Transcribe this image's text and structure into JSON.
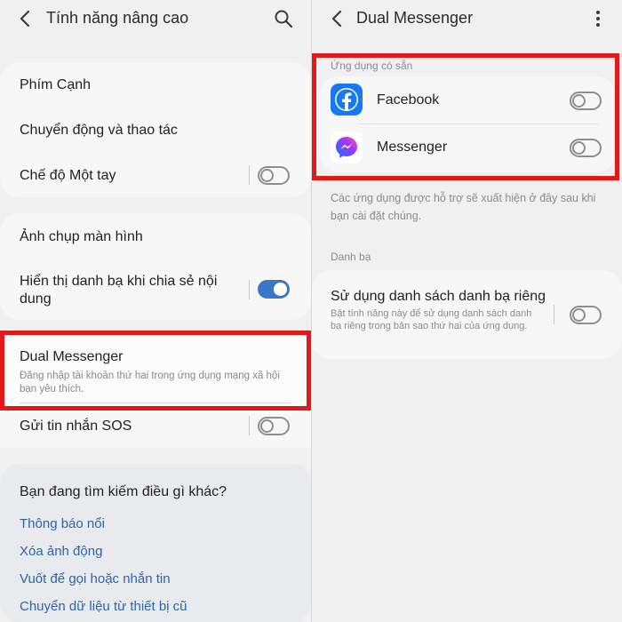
{
  "left": {
    "title": "Tính năng nâng cao",
    "items": {
      "edge_panels": "Phím Cạnh",
      "motions": "Chuyển động và thao tác",
      "one_handed": "Chế độ Một tay",
      "screenshot": "Ảnh chụp màn hình",
      "share_contacts": "Hiển thị danh bạ khi chia sẻ nội dung",
      "dual_messenger": "Dual Messenger",
      "dual_messenger_desc": "Đăng nhập tài khoản thứ hai trong ứng dụng mạng xã hội bạn yêu thích.",
      "sos": "Gửi tin nhắn SOS"
    },
    "looking_for": {
      "heading": "Bạn đang tìm kiếm điều gì khác?",
      "links": [
        "Thông báo nổi",
        "Xóa ảnh động",
        "Vuốt để gọi hoặc nhắn tin",
        "Chuyển dữ liệu từ thiết bị cũ"
      ]
    }
  },
  "right": {
    "title": "Dual Messenger",
    "available_apps_label": "Ứng dụng có sẵn",
    "apps": [
      {
        "name": "Facebook",
        "icon": "facebook-icon",
        "enabled": false
      },
      {
        "name": "Messenger",
        "icon": "messenger-icon",
        "enabled": false
      }
    ],
    "supported_note": "Các ứng dụng được hỗ trợ sẽ xuất hiện ở đây sau khi bạn cài đặt chúng.",
    "contacts_label": "Danh bạ",
    "separate_contacts_title": "Sử dụng danh sách danh bạ riêng",
    "separate_contacts_desc": "Bật tính năng này để sử dụng danh sách danh bạ riêng trong bản sao thứ hai của ứng dụng."
  },
  "toggles": {
    "one_handed": false,
    "share_contacts": true,
    "sos": false,
    "separate_contacts": false
  },
  "colors": {
    "accent": "#3a77c9",
    "link": "#2f63a8",
    "highlight": "#e01a1a",
    "facebook": "#1877f2"
  }
}
